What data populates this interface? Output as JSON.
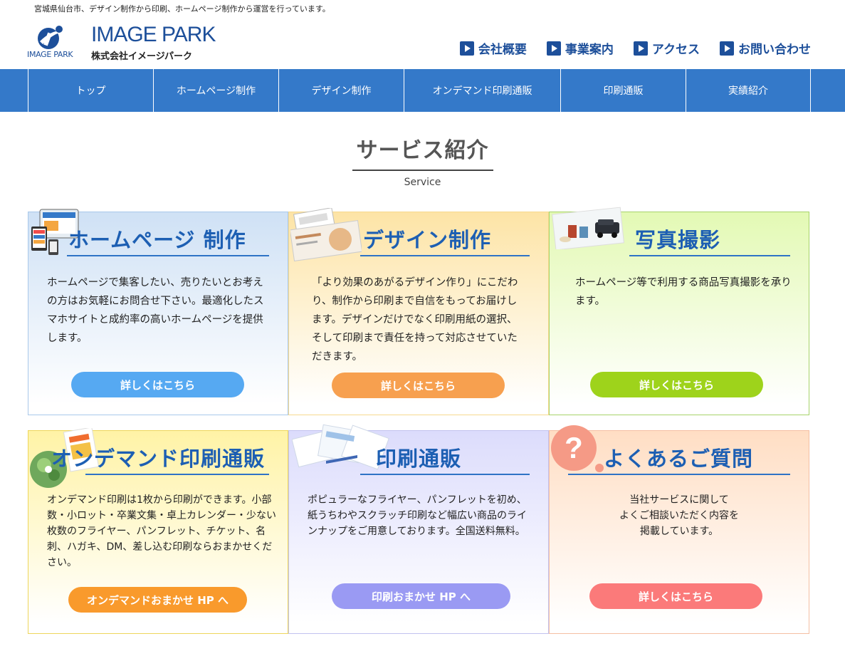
{
  "header": {
    "tagline": "宮城県仙台市、デザイン制作から印刷、ホームページ制作から運営を行っています。",
    "logo_title": "IMAGE PARK",
    "logo_sub": "IMAGE PARK",
    "logo_company": "株式会社イメージパーク",
    "links": [
      {
        "label": "会社概要",
        "icon": "play-icon"
      },
      {
        "label": "事業案内",
        "icon": "play-icon"
      },
      {
        "label": "アクセス",
        "icon": "play-icon"
      },
      {
        "label": "お問い合わせ",
        "icon": "play-icon"
      }
    ]
  },
  "nav": {
    "items": [
      {
        "label": "トップ"
      },
      {
        "label": "ホームページ制作"
      },
      {
        "label": "デザイン制作"
      },
      {
        "label": "オンデマンド印刷通販"
      },
      {
        "label": "印刷通販"
      },
      {
        "label": "実績紹介"
      }
    ]
  },
  "section": {
    "title": "サービス紹介",
    "subtitle": "Service"
  },
  "cards": [
    {
      "title": "ホームページ 制作",
      "body": "ホームページで集客したい、売りたいとお考えの方はお気軽にお問合せ下さい。最適化したスマホサイトと成約率の高いホームページを提供します。",
      "button": "詳しくはこちら",
      "accent": "#56a9f2"
    },
    {
      "title": "デザイン制作",
      "body": "「より効果のあがるデザイン作り」にこだわり、制作から印刷まで自信をもってお届けします。デザインだけでなく印刷用紙の選択、そして印刷まで責任を持って対応させていただきます。",
      "button": "詳しくはこちら",
      "accent": "#f7a04f"
    },
    {
      "title": "写真撮影",
      "body": "ホームページ等で利用する商品写真撮影を承ります。",
      "button": "詳しくはこちら",
      "accent": "#9ed31b"
    },
    {
      "title": "オンデマンド印刷通販",
      "body": "オンデマンド印刷は1枚から印刷ができます。小部数・小ロット・卒業文集・卓上カレンダー・少ない枚数のフライヤー、パンフレット、チケット、名刺、ハガキ、DM、差し込む印刷ならおまかせください。",
      "button": "オンデマンドおまかせ HP へ",
      "accent": "#f99a2c"
    },
    {
      "title": "印刷通販",
      "body": "ポピュラーなフライヤー、パンフレットを初め、紙うちわやスクラッチ印刷など幅広い商品のラインナップをご用意しております。全国送料無料。",
      "button": "印刷おまかせ HP へ",
      "accent": "#9a9af3"
    },
    {
      "title": "よくあるご質問",
      "body": "当社サービスに関して\nよくご相談いただく内容を\n掲載しています。",
      "button": "詳しくはこちら",
      "accent": "#fb7a7a"
    }
  ]
}
